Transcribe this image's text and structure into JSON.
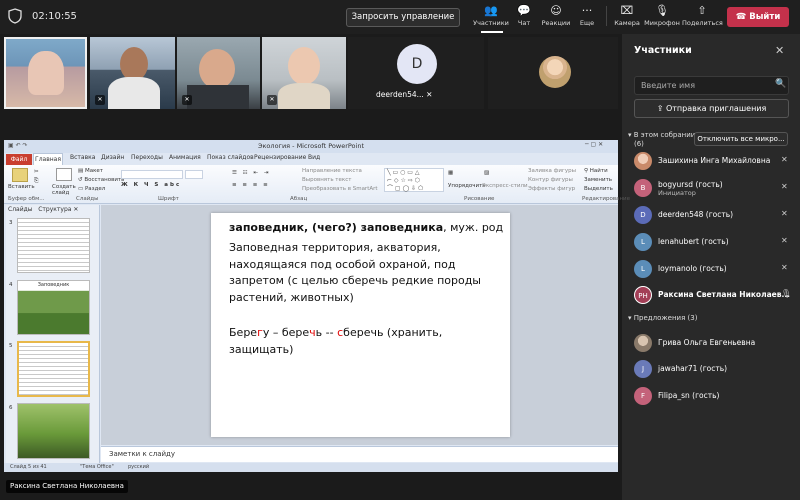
{
  "topbar": {
    "timer": "02:10:55",
    "request_control": "Запросить управление",
    "items": [
      {
        "label": "Участники",
        "icon": "people-icon"
      },
      {
        "label": "Чат",
        "icon": "chat-icon"
      },
      {
        "label": "Реакции",
        "icon": "reaction-icon"
      },
      {
        "label": "Еще",
        "icon": "more-icon"
      },
      {
        "label": "Камера",
        "icon": "camera-off-icon"
      },
      {
        "label": "Микрофон",
        "icon": "mic-off-icon"
      },
      {
        "label": "Поделиться",
        "icon": "share-icon"
      }
    ],
    "leave": "Выйти"
  },
  "video": {
    "d_initial": "D",
    "d_name": "deerden54..."
  },
  "panel": {
    "title": "Участники",
    "search_placeholder": "Введите имя",
    "invite": "Отправка приглашения",
    "in_meeting": "В этом собрании",
    "in_meeting_count": "(6)",
    "mute_all": "Отключить все микро...",
    "participants": [
      {
        "initials": "",
        "name": "Зашихина Инга Михайловна",
        "sub": "",
        "color": "#c98a6a"
      },
      {
        "initials": "B",
        "name": "bogyursd (гость)",
        "sub": "Инициатор",
        "color": "#c4627a"
      },
      {
        "initials": "D",
        "name": "deerden548 (гость)",
        "sub": "",
        "color": "#5b6bb8"
      },
      {
        "initials": "L",
        "name": "lenahubert (гость)",
        "sub": "",
        "color": "#5b8db8"
      },
      {
        "initials": "L",
        "name": "loymanolo (гость)",
        "sub": "",
        "color": "#5b8db8"
      },
      {
        "initials": "PH",
        "name": "Раксина Светлана Николаев...",
        "sub": "",
        "color": "#a33f57"
      }
    ],
    "suggestions": "Предложения (3)",
    "suggested": [
      {
        "initials": "",
        "name": "Грива Ольга Евгеньевна",
        "color": "#8a7a6a"
      },
      {
        "initials": "J",
        "name": "jawahar71 (гость)",
        "color": "#6a7ab8"
      },
      {
        "initials": "F",
        "name": "Filipa_sn (гость)",
        "color": "#c4627a"
      }
    ]
  },
  "ppt": {
    "title": "Экология - Microsoft PowerPoint",
    "tabs": [
      "Файл",
      "Главная",
      "Вставка",
      "Дизайн",
      "Переходы",
      "Анимация",
      "Показ слайдов",
      "Рецензирование",
      "Вид"
    ],
    "ribbon": {
      "paste": "Вставить",
      "clipboard": "Буфер обм...",
      "new_slide": "Создать слайд",
      "layout": "Макет",
      "reset": "Восстановить",
      "section": "Раздел",
      "slides_group": "Слайды",
      "font_group": "Шрифт",
      "paragraph_group": "Абзац",
      "text_dir": "Направление текста",
      "align_text": "Выровнять текст",
      "smartart": "Преобразовать в SmartArt",
      "arrange": "Упорядочить",
      "quick_styles": "Экспресс-стили",
      "fill": "Заливка фигуры",
      "outline": "Контур фигуры",
      "effects": "Эффекты фигур",
      "drawing_group": "Рисование",
      "find": "Найти",
      "replace": "Заменить",
      "select": "Выделить",
      "editing_group": "Редактирование"
    },
    "pane_tabs": {
      "slides": "Слайды",
      "outline": "Структура"
    },
    "thumbs": [
      {
        "num": "3"
      },
      {
        "num": "4",
        "title": "Заповедник"
      },
      {
        "num": "5"
      },
      {
        "num": "6"
      }
    ],
    "slide": {
      "head_bold": "заповедник, (чего?) заповедника",
      "head_rest": ", муж. род",
      "body": "Заповедная территория, акватория, находящаяся под особой охраной, под запретом (с целью сберечь редкие породы растений, животных)",
      "ex_1": "Бере",
      "ex_2": "г",
      "ex_3": "у – бере",
      "ex_4": "ч",
      "ex_5": "ь -- ",
      "ex_6": "с",
      "ex_7": "беречь  (хранить, защищать)"
    },
    "notes": "Заметки к слайду",
    "status": {
      "slide": "Слайд 5 из 41",
      "theme": "\"Тема Office\"",
      "lang": "русский"
    }
  },
  "presenter": "Раксина Светлана Николаевна"
}
